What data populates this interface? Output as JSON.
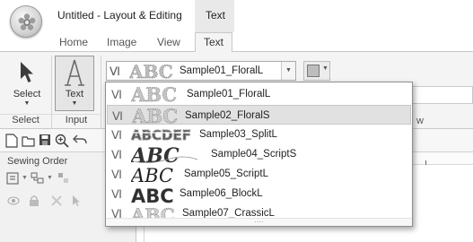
{
  "window": {
    "title": "Untitled - Layout & Editing",
    "context_tab_title": "Text"
  },
  "ribbon_tabs": [
    {
      "label": "Home"
    },
    {
      "label": "Image"
    },
    {
      "label": "View"
    },
    {
      "label": "Text",
      "active": true
    }
  ],
  "ribbon": {
    "select_button": {
      "label": "Select"
    },
    "text_button": {
      "label": "Text"
    },
    "group_select_label": "Select",
    "group_input_label": "Input",
    "group_partial_label": "w",
    "font_selector": {
      "value": "Sample01_FloralL"
    }
  },
  "left_panel": {
    "title": "Sewing Order"
  },
  "font_list": {
    "selected_index": 1,
    "items": [
      {
        "name": "Sample01_FloralL"
      },
      {
        "name": "Sample02_FloralS"
      },
      {
        "name": "Sample03_SplitL"
      },
      {
        "name": "Sample04_ScriptS"
      },
      {
        "name": "Sample05_ScriptL"
      },
      {
        "name": "Sample06_BlockL"
      },
      {
        "name": "Sample07_CrassicL"
      }
    ],
    "grip_glyph": "····"
  },
  "icons": [
    "app-orb-icon",
    "select-arrow-icon",
    "text-tool-icon",
    "font-type-icon",
    "new-icon",
    "open-icon",
    "save-icon",
    "zoom-icon",
    "undo-icon",
    "color-swatch-icon"
  ],
  "colors": {
    "ribbon_bg": "#f4f4f4",
    "selection_bg": "#e1e1e1",
    "text": "#222222"
  }
}
